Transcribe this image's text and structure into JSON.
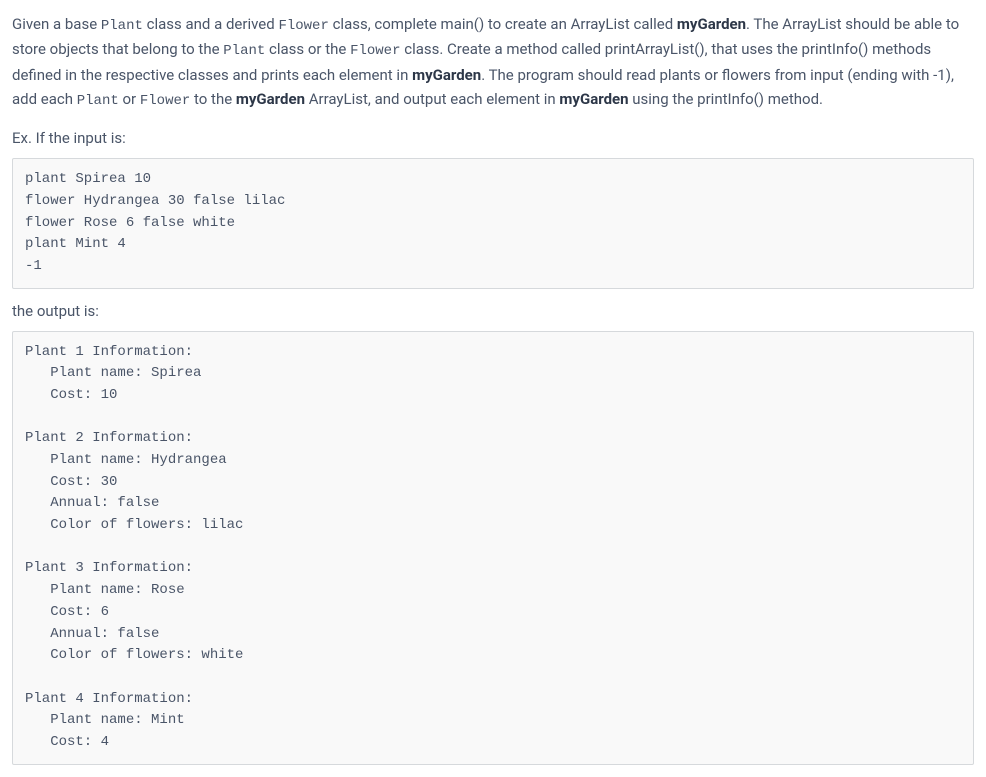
{
  "description": {
    "seg1": "Given a base ",
    "code1": "Plant",
    "seg2": " class and a derived ",
    "code2": "Flower",
    "seg3": " class, complete main() to create an ArrayList called ",
    "bold1": "myGarden",
    "seg4": ". The ArrayList should be able to store objects that belong to the ",
    "code3": "Plant",
    "seg5": " class or the ",
    "code4": "Flower",
    "seg6": " class. Create a method called printArrayList(), that uses the printInfo() methods defined in the respective classes and prints each element in ",
    "bold2": "myGarden",
    "seg7": ". The program should read plants or flowers from input (ending with -1), add each ",
    "code5": "Plant",
    "seg8": " or ",
    "code6": "Flower",
    "seg9": " to the ",
    "bold3": "myGarden",
    "seg10": " ArrayList, and output each element in ",
    "bold4": "myGarden",
    "seg11": " using the printInfo() method."
  },
  "example_label": "Ex. If the input is:",
  "input_block": "plant Spirea 10\nflower Hydrangea 30 false lilac\nflower Rose 6 false white\nplant Mint 4\n-1",
  "output_label": "the output is:",
  "output_block": "Plant 1 Information:\n   Plant name: Spirea\n   Cost: 10\n\nPlant 2 Information:\n   Plant name: Hydrangea\n   Cost: 30\n   Annual: false\n   Color of flowers: lilac\n\nPlant 3 Information:\n   Plant name: Rose\n   Cost: 6\n   Annual: false\n   Color of flowers: white\n\nPlant 4 Information:\n   Plant name: Mint\n   Cost: 4"
}
